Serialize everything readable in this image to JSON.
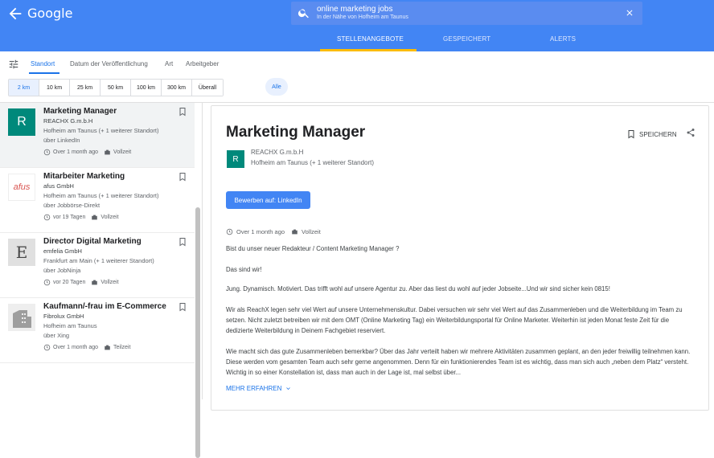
{
  "app": {
    "logo": "Google"
  },
  "search": {
    "query": "online marketing jobs",
    "subtitle": "In der Nähe von Hofheim am Taunus"
  },
  "tabs": [
    {
      "label": "STELLENANGEBOTE"
    },
    {
      "label": "GESPEICHERT"
    },
    {
      "label": "ALERTS"
    }
  ],
  "filters": {
    "tabs": [
      {
        "label": "Standort"
      },
      {
        "label": "Datum der Veröffentlichung"
      },
      {
        "label": "Art"
      },
      {
        "label": "Arbeitgeber"
      }
    ],
    "distances": [
      "2 km",
      "10 km",
      "25 km",
      "50 km",
      "100 km",
      "300 km",
      "Überall"
    ],
    "selected_distance": "2 km",
    "all_label": "Alle"
  },
  "jobs": [
    {
      "title": "Marketing Manager",
      "company": "REACHX G.m.b.H",
      "location": "Hofheim am Taunus (+ 1 weiterer Standort)",
      "via": "über LinkedIn",
      "age": "Over 1 month ago",
      "type": "Vollzeit",
      "logo_letter": "R"
    },
    {
      "title": "Mitarbeiter Marketing",
      "company": "afus GmbH",
      "location": "Hofheim am Taunus (+ 1 weiterer Standort)",
      "via": "über Jobbörse-Direkt",
      "age": "vor 19 Tagen",
      "type": "Vollzeit",
      "logo_letter": "afus"
    },
    {
      "title": "Director Digital Marketing",
      "company": "emfelia GmbH",
      "location": "Frankfurt am Main (+ 1 weiterer Standort)",
      "via": "über JobNinja",
      "age": "vor 20 Tagen",
      "type": "Vollzeit",
      "logo_letter": "E"
    },
    {
      "title": "Kaufmann/-frau im E-Commerce",
      "company": "Fibrolux GmbH",
      "location": "Hofheim am Taunus",
      "via": "über Xing",
      "age": "Over 1 month ago",
      "type": "Teilzeit",
      "logo_letter": ""
    }
  ],
  "detail": {
    "title": "Marketing Manager",
    "save_label": "SPEICHERN",
    "logo_letter": "R",
    "company": "REACHX G.m.b.H",
    "location": "Hofheim am Taunus (+ 1 weiterer Standort)",
    "apply_label": "Bewerben auf: LinkedIn",
    "age": "Over 1 month ago",
    "type": "Vollzeit",
    "paragraphs": [
      "Bist du unser neuer Redakteur / Content Marketing Manager ?",
      "Das sind wir!",
      "Jung. Dynamisch. Motiviert. Das trifft wohl auf unsere Agentur zu. Aber das liest du wohl auf jeder Jobseite...Und wir sind sicher kein 0815!",
      "Wir als ReachX legen sehr viel Wert auf unsere Unternehmenskultur. Dabei versuchen wir sehr viel Wert auf das Zusammenleben und die Weiterbildung im Team zu setzen. Nicht zuletzt betreiben wir mit dem OMT (Online Marketing Tag) ein Weiterbildungsportal für Online Marketer. Weiterhin ist jeden Monat feste Zeit für die dedizierte Weiterbildung in Deinem Fachgebiet reserviert.",
      "Wie macht sich das gute Zusammenleben bemerkbar? Über das Jahr verteilt haben wir mehrere Aktivitäten zusammen geplant, an den jeder freiwillig teilnehmen kann. Diese werden vom gesamten Team auch sehr gerne angenommen. Denn für ein funktionierendes Team ist es wichtig, dass man sich auch „neben dem Platz“ versteht. Wichtig in so einer Konstellation ist, dass man auch in der Lage ist, mal selbst über..."
    ],
    "more_label": "MEHR ERFAHREN"
  },
  "colors": {
    "brand": "#4285f4",
    "accent": "#fbbc04",
    "link": "#1a73e8",
    "logo_green": "#00897b"
  }
}
